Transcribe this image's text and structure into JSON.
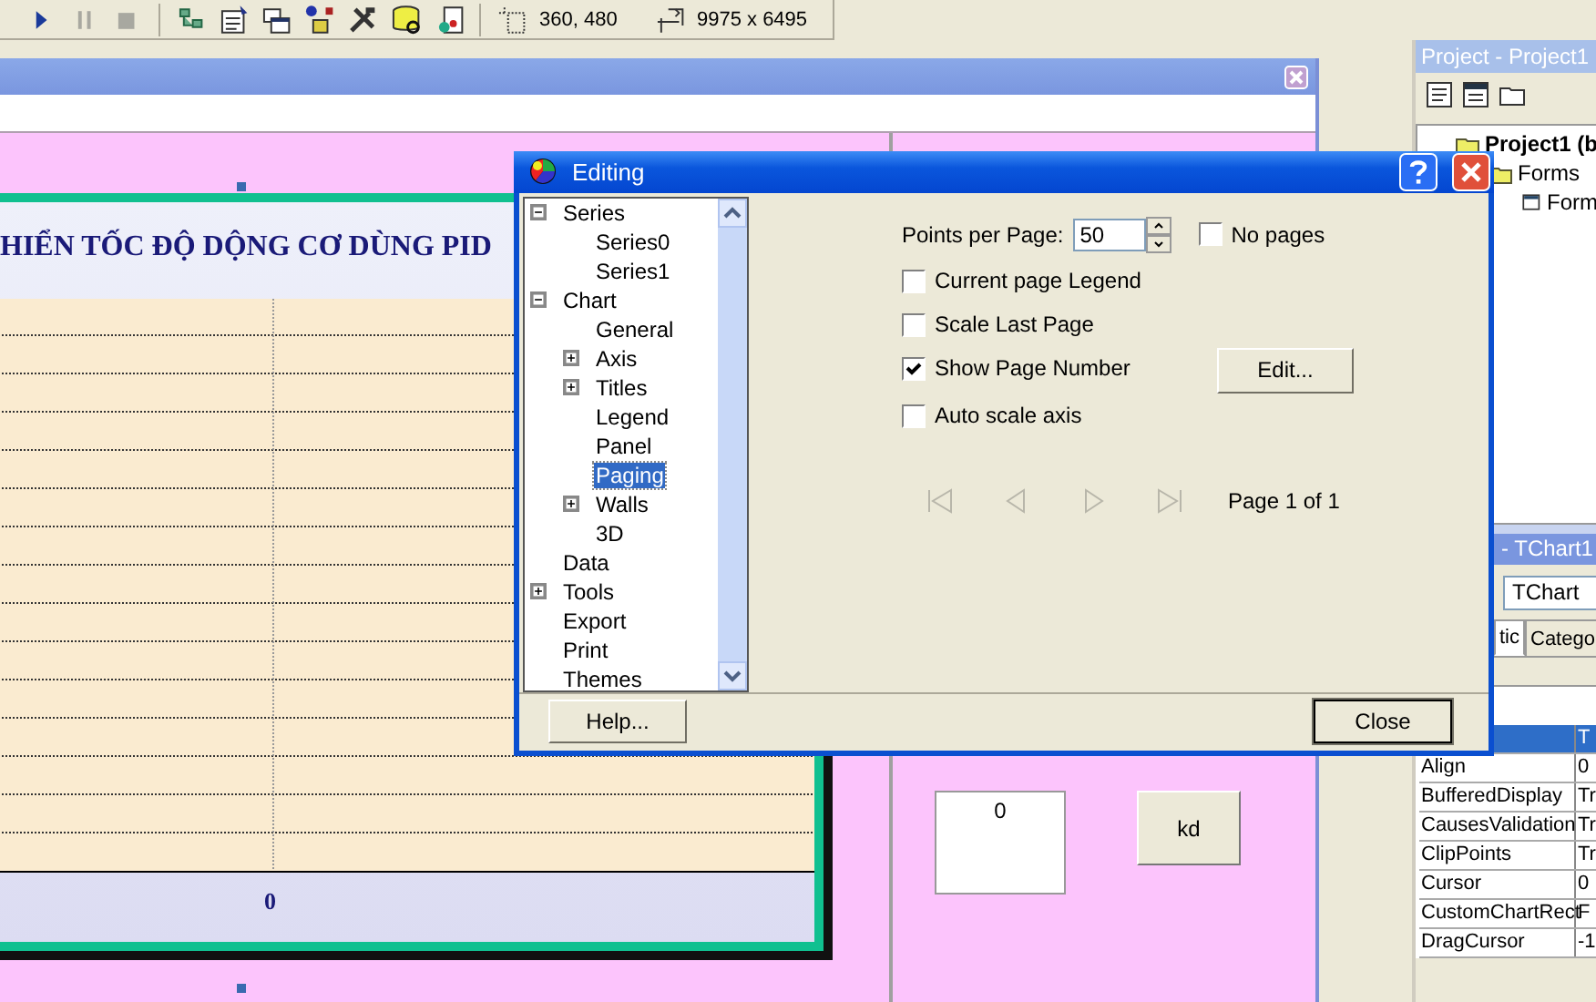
{
  "toolbar": {
    "run_controls": [
      {
        "kind": "play",
        "disabled": false
      },
      {
        "kind": "pause",
        "disabled": true
      },
      {
        "kind": "stop",
        "disabled": true
      }
    ],
    "position": "360, 480",
    "size": "9975 x 6495"
  },
  "form_designer": {
    "chart": {
      "title": "HIỂN TỐC ĐỘ DỘNG CƠ DÙNG PID",
      "axis_label": "0"
    },
    "value_box": "0",
    "button": "kd"
  },
  "project_manager": {
    "title": "Project - Project1",
    "tree": [
      {
        "label": "Project1 (b",
        "children": [
          {
            "label": "Forms",
            "children": [
              {
                "label": "Form"
              }
            ]
          }
        ]
      }
    ]
  },
  "object_inspector": {
    "title": "- TChart1",
    "object": "TChart",
    "tabs": [
      {
        "label": "tic",
        "selected": true
      },
      {
        "label": "Catego",
        "selected": false
      }
    ],
    "properties": [
      {
        "value": "T",
        "selected": true
      },
      {
        "name": "Align",
        "value": "0",
        "selected": false
      },
      {
        "name": "BufferedDisplay",
        "value": "Tr",
        "selected": false
      },
      {
        "name": "CausesValidation",
        "value": "Tr",
        "selected": false
      },
      {
        "name": "ClipPoints",
        "value": "Tr",
        "selected": false
      },
      {
        "name": "Cursor",
        "value": "0",
        "selected": false
      },
      {
        "name": "CustomChartRect",
        "value": "F",
        "selected": false
      },
      {
        "name": "DragCursor",
        "value": "-1",
        "selected": false
      }
    ]
  },
  "dialog": {
    "title": "Editing",
    "tree": [
      {
        "label": "Series",
        "expanded": true,
        "selected": false,
        "children": [
          {
            "label": "Series0",
            "selected": false
          },
          {
            "label": "Series1",
            "selected": false
          }
        ]
      },
      {
        "label": "Chart",
        "expanded": true,
        "selected": false,
        "children": [
          {
            "label": "General",
            "selected": false
          },
          {
            "label": "Axis",
            "expanded": false,
            "selected": false
          },
          {
            "label": "Titles",
            "expanded": false,
            "selected": false
          },
          {
            "label": "Legend",
            "selected": false
          },
          {
            "label": "Panel",
            "selected": false
          },
          {
            "label": "Paging",
            "selected": true
          },
          {
            "label": "Walls",
            "expanded": false,
            "selected": false
          },
          {
            "label": "3D",
            "selected": false
          }
        ]
      },
      {
        "label": "Data",
        "selected": false
      },
      {
        "label": "Tools",
        "expanded": false,
        "selected": false
      },
      {
        "label": "Export",
        "selected": false
      },
      {
        "label": "Print",
        "selected": false
      },
      {
        "label": "Themes",
        "selected": false
      }
    ],
    "points_per_page": {
      "label": "Points per Page:",
      "value": "50"
    },
    "no_pages": {
      "label": "No pages",
      "checked": false
    },
    "options": [
      {
        "label": "Current page Legend",
        "checked": false
      },
      {
        "label": "Scale Last Page",
        "checked": false
      },
      {
        "label": "Show Page Number",
        "checked": true,
        "button": "Edit..."
      },
      {
        "label": "Auto scale axis",
        "checked": false
      }
    ],
    "pager": {
      "buttons": [
        {
          "kind": "first",
          "disabled": true
        },
        {
          "kind": "prev",
          "disabled": true
        },
        {
          "kind": "next",
          "disabled": true
        },
        {
          "kind": "last",
          "disabled": true
        }
      ],
      "label": "Page 1 of 1"
    },
    "help_button": "Help...",
    "close_button": "Close"
  }
}
